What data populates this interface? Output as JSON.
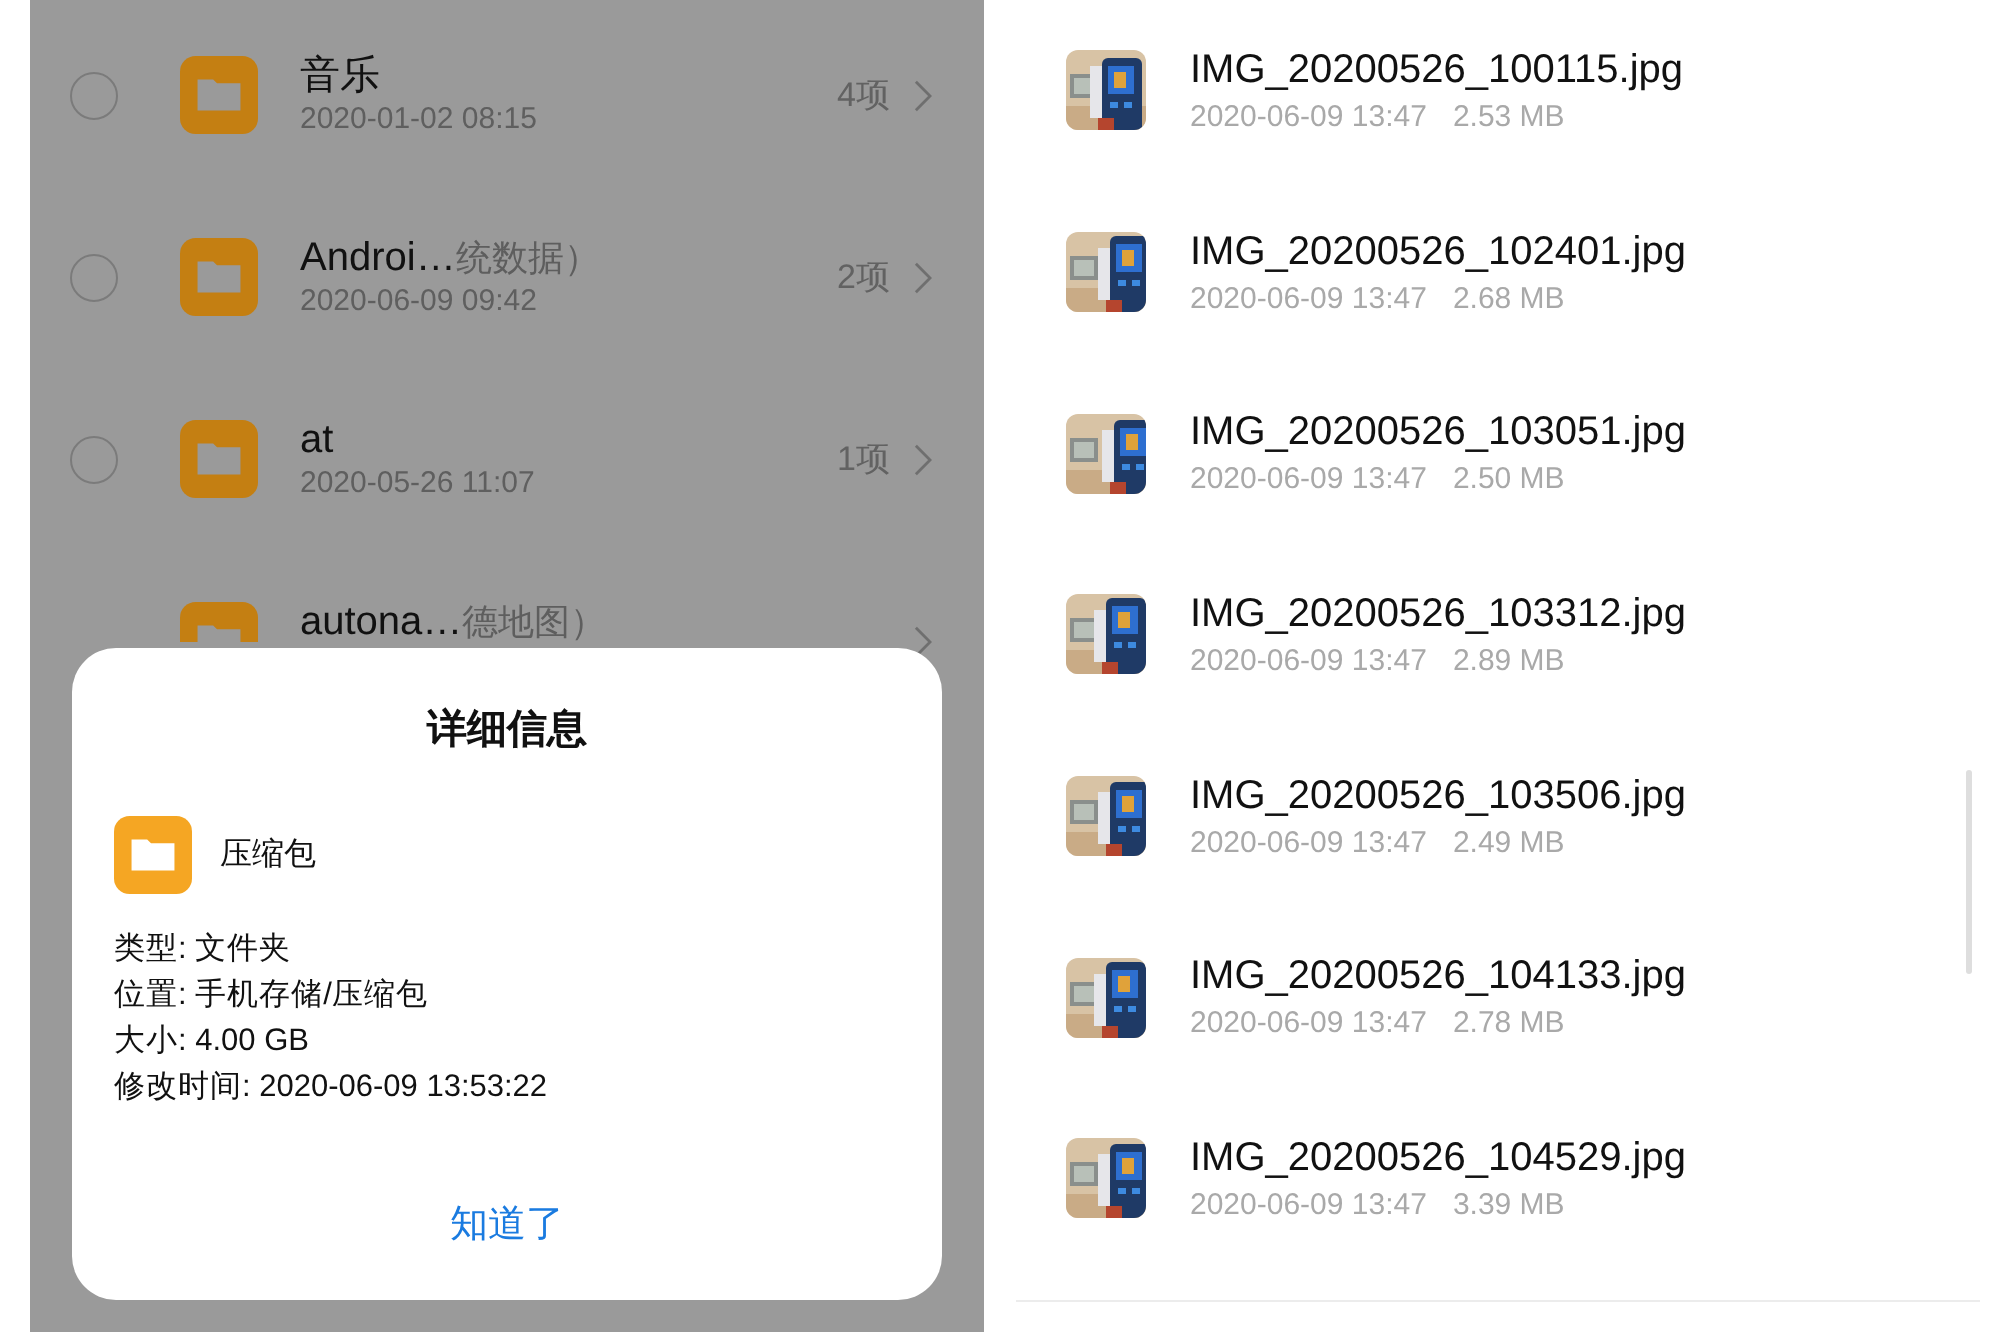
{
  "left_screen": {
    "folders": [
      {
        "name": "音乐",
        "date": "2020-01-02 08:15",
        "count": "4项",
        "selected": false
      },
      {
        "name": "Androi…",
        "name_suffix": "统数据）",
        "date": "2020-06-09 09:42",
        "count": "2项",
        "selected": false
      },
      {
        "name": "at",
        "date": "2020-05-26 11:07",
        "count": "1项",
        "selected": false
      },
      {
        "name": "autona…",
        "name_suffix": "德地图）"
      }
    ],
    "dialog": {
      "title": "详细信息",
      "item_name": "压缩包",
      "details": [
        "类型: 文件夹",
        "位置: 手机存储/压缩包",
        "大小: 4.00 GB",
        "修改时间: 2020-06-09 13:53:22"
      ],
      "button": "知道了"
    }
  },
  "right_screen": {
    "files": [
      {
        "name": "IMG_20200526_100115.jpg",
        "date": "2020-06-09 13:47",
        "size": "2.53 MB",
        "kind": "picture"
      },
      {
        "name": "IMG_20200526_102401.jpg",
        "date": "2020-06-09 13:47",
        "size": "2.68 MB",
        "kind": "picture"
      },
      {
        "name": "IMG_20200526_103051.jpg",
        "date": "2020-06-09 13:47",
        "size": "2.50 MB",
        "kind": "picture"
      },
      {
        "name": "IMG_20200526_103312.jpg",
        "date": "2020-06-09 13:47",
        "size": "2.89 MB",
        "kind": "picture"
      },
      {
        "name": "IMG_20200526_103506.jpg",
        "date": "2020-06-09 13:47",
        "size": "2.49 MB",
        "kind": "picture"
      },
      {
        "name": "IMG_20200526_104133.jpg",
        "date": "2020-06-09 13:47",
        "size": "2.78 MB",
        "kind": "picture"
      },
      {
        "name": "IMG_20200526_104529.jpg",
        "date": "2020-06-09 13:47",
        "size": "3.39 MB",
        "kind": "picture"
      }
    ]
  }
}
